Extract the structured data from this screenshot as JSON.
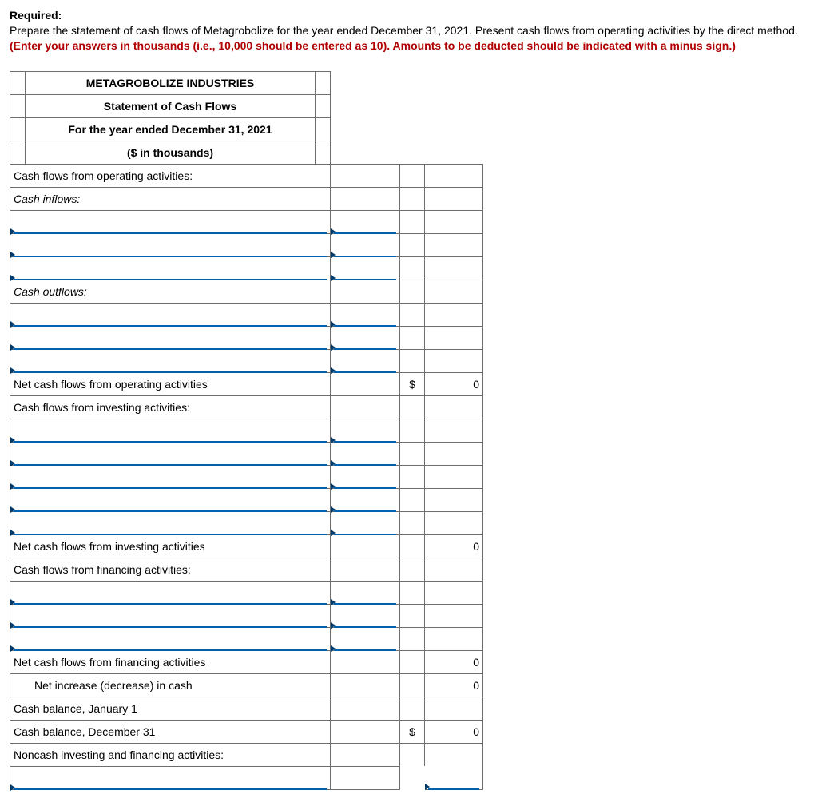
{
  "required_label": "Required:",
  "instr_plain": "Prepare the statement of cash flows of Metagrobolize for the year ended December 31, 2021. Present cash flows from operating activities by the direct method. ",
  "instr_red": "(Enter your answers in thousands (i.e., 10,000 should be entered as 10). Amounts to be deducted should be indicated with a minus sign.)",
  "hdr": {
    "company": "METAGROBOLIZE INDUSTRIES",
    "title": "Statement of Cash Flows",
    "period": "For the year ended December 31, 2021",
    "units": "($ in thousands)"
  },
  "rows": {
    "cfo_heading": "Cash flows from operating activities:",
    "cash_inflows": "Cash inflows:",
    "cash_outflows": "Cash outflows:",
    "net_cfo": "Net cash flows from operating activities",
    "cfi_heading": "Cash flows from investing activities:",
    "net_cfi": "Net cash flows from investing activities",
    "cff_heading": "Cash flows from financing activities:",
    "net_cff": "Net cash flows from financing activities",
    "net_change": "Net increase (decrease) in cash",
    "bal_jan1": "Cash balance, January 1",
    "bal_dec31": "Cash balance, December 31",
    "noncash": "Noncash investing and financing activities:"
  },
  "vals": {
    "currency": "$",
    "zero": "0"
  }
}
